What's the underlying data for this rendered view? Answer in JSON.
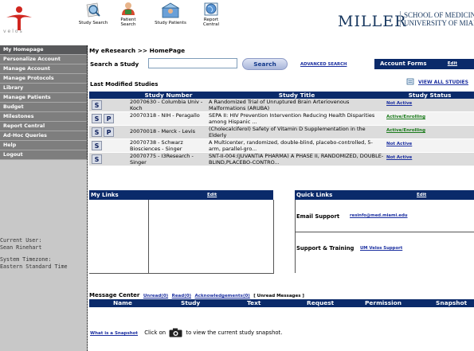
{
  "header": {
    "logo_text": "velos",
    "toolbar": [
      {
        "label_line1": "Study Search",
        "label_line2": "",
        "icon": "magnifier-icon"
      },
      {
        "label_line1": "Patient",
        "label_line2": "Search",
        "icon": "patient-icon"
      },
      {
        "label_line1": "Study Patients",
        "label_line2": "",
        "icon": "study-patients-icon"
      },
      {
        "label_line1": "Report",
        "label_line2": "Central",
        "icon": "report-globe-icon"
      }
    ],
    "brand": "MILLER",
    "school_line1": "SCHOOL OF MEDICINE",
    "school_line2": "UNIVERSITY OF MIAMI"
  },
  "sidebar": {
    "items": [
      {
        "label": "My Homepage",
        "active": true
      },
      {
        "label": "Personalize Account"
      },
      {
        "label": "Manage Account"
      },
      {
        "label": "Manage Protocols"
      },
      {
        "label": "Library"
      },
      {
        "label": "Manage Patients"
      },
      {
        "label": "Budget"
      },
      {
        "label": "Milestones"
      },
      {
        "label": "Report Central"
      },
      {
        "label": "Ad-Hoc Queries"
      },
      {
        "label": "Help"
      },
      {
        "label": "Logout"
      }
    ],
    "current_user_label": "Current User:",
    "current_user": "Sean Rinehart",
    "timezone_label": "System Timezone:",
    "timezone": "Eastern Standard Time"
  },
  "main": {
    "breadcrumb": "My eResearch >> HomePage",
    "search_label": "Search a Study",
    "search_value": "",
    "search_button": "Search",
    "advanced_search": "ADVANCED SEARCH",
    "account_forms": "Account Forms",
    "account_forms_edit": "Edit",
    "last_modified_title": "Last Modified Studies",
    "view_all": "VIEW ALL STUDIES",
    "table": {
      "headers": [
        "",
        "Study Number",
        "Study Title",
        "Study Status"
      ],
      "rows": [
        {
          "actions": [
            "S"
          ],
          "number": "20070630 - Columbia Univ - Koch",
          "title": "A Randomized Trial of Unruptured Brain Arteriovenous Malformations (ARUBA)",
          "status": "Not Active",
          "status_color": "#1b2fa0"
        },
        {
          "actions": [
            "S",
            "P"
          ],
          "number": "20070318 - NIH - Peragallo",
          "title": "SEPA II: HIV Prevention Intervention Reducing Health Disparities among Hispanic ...",
          "status": "Active/Enrolling",
          "status_color": "#1a7a1a"
        },
        {
          "actions": [
            "S",
            "P"
          ],
          "number": "20070018 - Merck - Levis",
          "title": "(Cholecalciferol) Safety of Vitamin D Supplementation in the Elderly",
          "status": "Active/Enrolling",
          "status_color": "#1a7a1a"
        },
        {
          "actions": [
            "S"
          ],
          "number": "20070738 - Schwarz Biosciences - Singer",
          "title": "A Multicenter, randomized, double-blind, placebo-controlled, 5-arm, parallel-gro...",
          "status": "Not Active",
          "status_color": "#1b2fa0"
        },
        {
          "actions": [
            "S"
          ],
          "number": "20070775 - I3Research - Singer",
          "title": "SNT-II-004:(JUVANTIA PHARMA) A PHASE II, RANDOMIZED, DOUBLE-BLIND,PLACEBO-CONTRO...",
          "status": "Not Active",
          "status_color": "#1b2fa0"
        }
      ]
    },
    "my_links": {
      "title": "My Links",
      "edit": "Edit"
    },
    "quick_links": {
      "title": "Quick Links",
      "edit": "Edit",
      "email_label": "Email Support",
      "email_value": "resinfo@med.miami.edu",
      "support_label": "Support & Training",
      "support_value": "UM Velos Support"
    },
    "message_center": {
      "title": "Message Center",
      "unread": "Unread(0)",
      "read": "Read(0)",
      "ack": "Acknowledgements(0)",
      "mode": "[ Unread Messages ]",
      "columns": [
        "Name",
        "Study",
        "Text",
        "Request",
        "Permission",
        "Snapshot"
      ]
    },
    "snapshot": {
      "link": "What is a Snapshot",
      "before": "Click on",
      "after": "to view the current study snapshot."
    }
  },
  "colors": {
    "navy_bar": "#0a2a6a",
    "sidebar_item": "#7e7e7e",
    "sidebar_bg": "#c8c8c8",
    "link_blue": "#1b2fa0",
    "status_green": "#1a7a1a",
    "brand_navy": "#16365e",
    "logo_red": "#d0261f"
  }
}
